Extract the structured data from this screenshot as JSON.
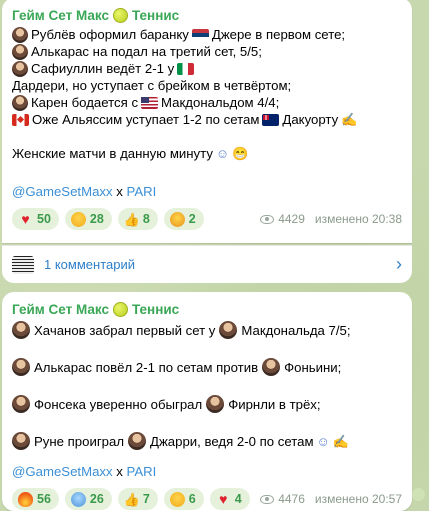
{
  "colors": {
    "channel": "#3aa757",
    "link": "#3a8fd6",
    "reaction_bg": "#e6f1dc",
    "reaction_text": "#3a9a4a"
  },
  "post1": {
    "channel": "Гейм Сет Макс",
    "channel_suffix": "Теннис",
    "lines": [
      {
        "text": "Рублёв оформил баранку",
        "flag": "rs-flag",
        "text2": "Джере в первом сете;"
      },
      {
        "text": "Алькарас на подал на третий сет, 5/5;"
      },
      {
        "text": "Сафиуллин ведёт 2-1 у",
        "flag": "it-flag",
        "text2": "Дардери, но уступает с брейком в четвёртом;"
      },
      {
        "text": "Карен бодается с",
        "flag": "us-flag",
        "text2": "Макдональдом 4/4;"
      },
      {
        "text": "Оже Альяссим уступает 1-2 по сетам",
        "flag": "au-flag",
        "text2": "Дакуорту"
      }
    ],
    "line_women": "Женские матчи в данную минуту",
    "link": "@GameSetMaxx",
    "link_x": "x",
    "link_pari": "PARI",
    "reactions": [
      {
        "icon": "heart-icon",
        "count": "50"
      },
      {
        "icon": "grin-icon",
        "count": "28"
      },
      {
        "icon": "thumbs-up-icon",
        "count": "8"
      },
      {
        "icon": "shocked-icon",
        "count": "2"
      }
    ],
    "views": "4429",
    "edited": "изменено 20:38"
  },
  "comments": {
    "label": "1 комментарий"
  },
  "post2": {
    "channel": "Гейм Сет Макс",
    "channel_suffix": "Теннис",
    "lines": [
      {
        "a": "Хачанов забрал первый сет у",
        "b": "Макдональда 7/5;"
      },
      {
        "a": "Алькарас повёл 2-1 по сетам против",
        "b": "Фоньини;"
      },
      {
        "a": "Фонсека уверенно обыграл",
        "b": "Фирнли в трёх;"
      },
      {
        "a": "Руне проиграл",
        "b": "Джарри, ведя 2-0 по сетам"
      }
    ],
    "link": "@GameSetMaxx",
    "link_x": "x",
    "link_pari": "PARI",
    "reactions": [
      {
        "icon": "fire-icon",
        "count": "56"
      },
      {
        "icon": "scream-icon",
        "count": "26"
      },
      {
        "icon": "thumbs-up-icon",
        "count": "7"
      },
      {
        "icon": "grin-icon",
        "count": "6"
      },
      {
        "icon": "heart-icon",
        "count": "4"
      }
    ],
    "views": "4476",
    "edited": "изменено 20:57"
  }
}
